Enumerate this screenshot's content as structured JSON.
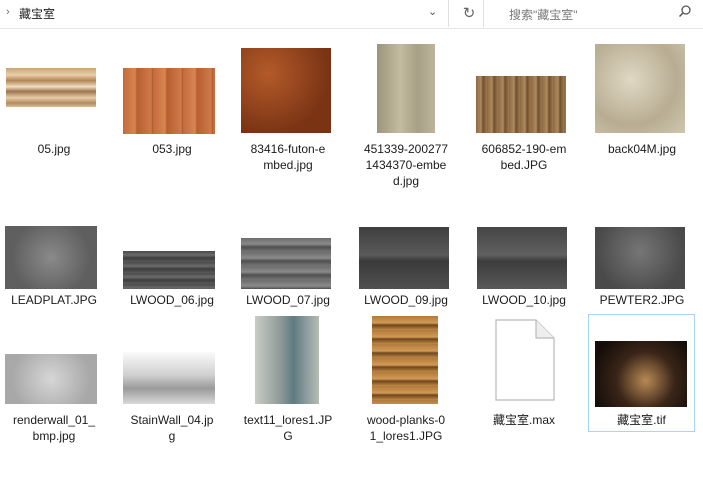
{
  "toolbar": {
    "path_label": "藏宝室",
    "search_placeholder": "搜索\"藏宝室\""
  },
  "files": [
    {
      "name": "05.jpg"
    },
    {
      "name": "053.jpg"
    },
    {
      "name": "83416-futon-embed.jpg"
    },
    {
      "name": "451339-2002771434370-embed.jpg"
    },
    {
      "name": "606852-190-embed.JPG"
    },
    {
      "name": "back04M.jpg"
    },
    {
      "name": "LEADPLAT.JPG"
    },
    {
      "name": "LWOOD_06.jpg"
    },
    {
      "name": "LWOOD_07.jpg"
    },
    {
      "name": "LWOOD_09.jpg"
    },
    {
      "name": "LWOOD_10.jpg"
    },
    {
      "name": "PEWTER2.JPG"
    },
    {
      "name": "renderwall_01_bmp.jpg"
    },
    {
      "name": "StainWall_04.jpg"
    },
    {
      "name": "text11_lores1.JPG"
    },
    {
      "name": "wood-planks-01_lores1.JPG"
    },
    {
      "name": "藏宝室.max"
    },
    {
      "name": "藏宝室.tif",
      "selected": true
    }
  ],
  "labels": {
    "f0": "05.jpg",
    "f1": "053.jpg",
    "f2a": "83416-futon-e",
    "f2b": "mbed.jpg",
    "f3a": "451339-200277",
    "f3b": "1434370-embe",
    "f3c": "d.jpg",
    "f4a": "606852-190-em",
    "f4b": "bed.JPG",
    "f5": "back04M.jpg",
    "f6": "LEADPLAT.JPG",
    "f7": "LWOOD_06.jpg",
    "f8": "LWOOD_07.jpg",
    "f9": "LWOOD_09.jpg",
    "f10": "LWOOD_10.jpg",
    "f11": "PEWTER2.JPG",
    "f12a": "renderwall_01_",
    "f12b": "bmp.jpg",
    "f13a": "StainWall_04.jp",
    "f13b": "g",
    "f14a": "text11_lores1.JP",
    "f14b": "G",
    "f15a": "wood-planks-0",
    "f15b": "1_lores1.JPG",
    "f16": "藏宝室.max",
    "f17": "藏宝室.tif"
  }
}
